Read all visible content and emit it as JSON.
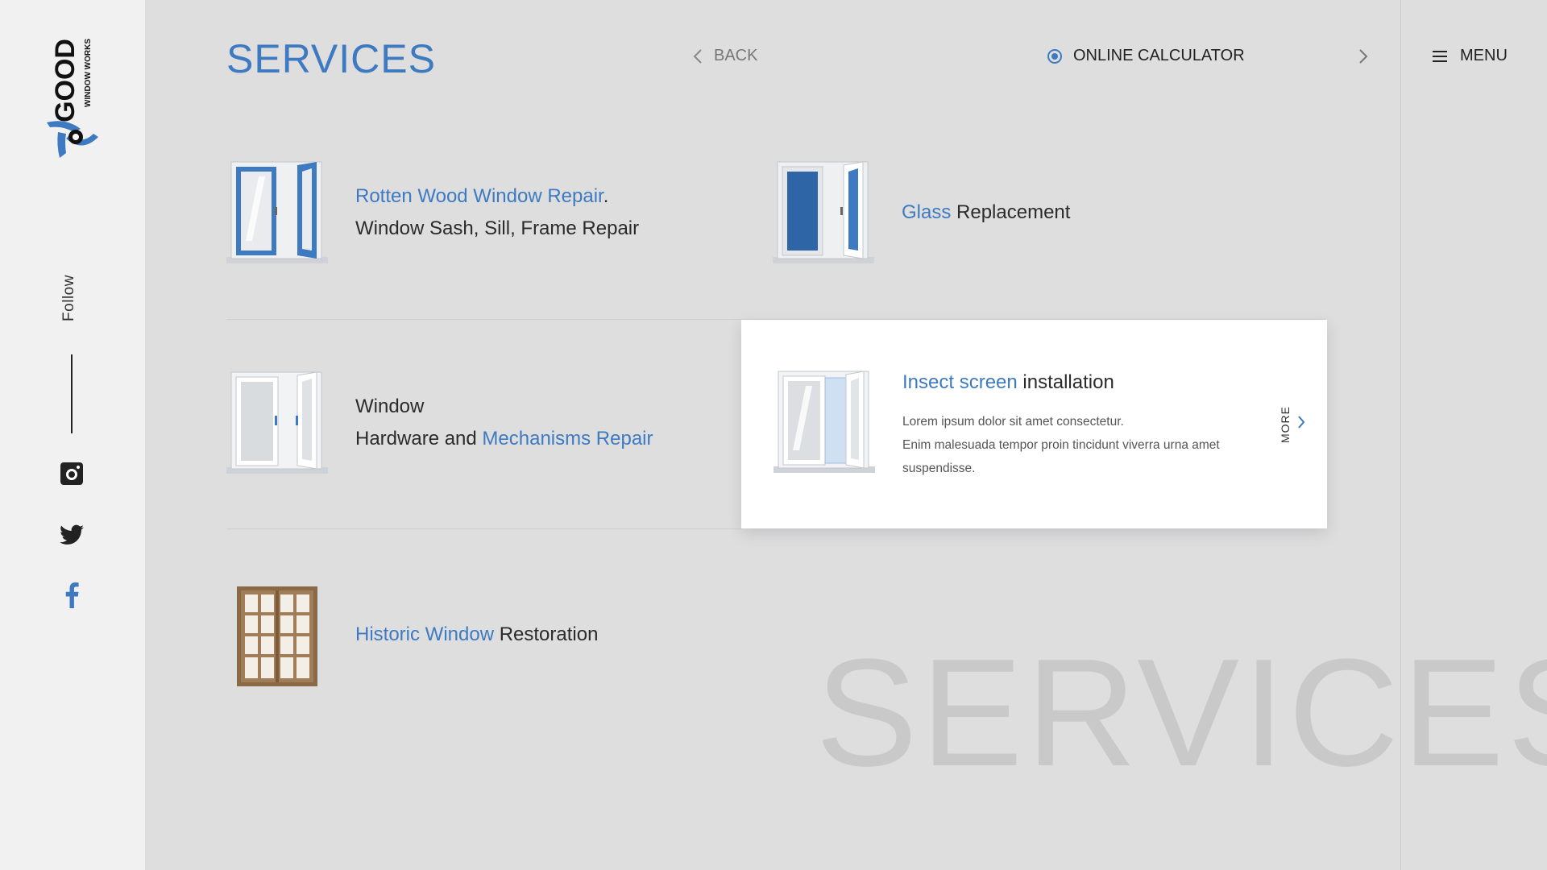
{
  "brand": {
    "name": "GOOD",
    "tagline": "WINDOW WORKS"
  },
  "sidebar": {
    "follow_label": "Follow"
  },
  "header": {
    "title": "SERVICES",
    "back_label": "BACK",
    "calculator_label": "ONLINE CALCULATOR",
    "menu_label": "MENU"
  },
  "services": [
    {
      "accent": "Rotten Wood Window Repair",
      "plain": ".",
      "line2": "Window Sash, Sill, Frame Repair"
    },
    {
      "accent": "Glass",
      "plain": " Replacement"
    },
    {
      "line1": "Window",
      "line2_plain": "Hardware and ",
      "line2_accent": "Mechanisms Repair"
    },
    {
      "accent": "Insect screen",
      "plain": " installation",
      "desc_line1": "Lorem ipsum dolor sit amet consectetur.",
      "desc_line2": "Enim malesuada tempor proin tincidunt viverra urna amet suspendisse.",
      "more_label": "MORE"
    },
    {
      "accent": "Historic Window",
      "plain": " Restoration"
    }
  ],
  "background_word": "SERVICES",
  "colors": {
    "accent": "#3d7ac1",
    "background": "#dededf",
    "sidebar": "#f1f1f1"
  },
  "icons": [
    "instagram-icon",
    "twitter-icon",
    "facebook-icon",
    "chevron-left-icon",
    "chevron-right-icon",
    "hamburger-icon",
    "radio-icon"
  ]
}
